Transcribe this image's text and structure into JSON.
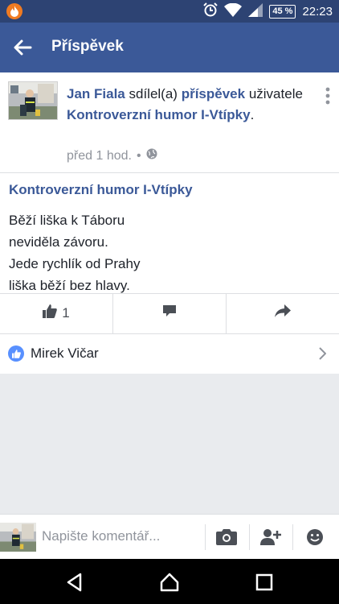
{
  "status_bar": {
    "battery": "45 %",
    "time": "22:23"
  },
  "app_bar": {
    "title": "Příspěvek"
  },
  "post": {
    "author": "Jan Fiala",
    "shared_text": "sdílel(a)",
    "post_link": "příspěvek",
    "user_text": "uživatele",
    "group": "Kontroverzní humor I-Vtípky",
    "period": ".",
    "time": "před 1 hod.",
    "dot": "•",
    "group_header": "Kontroverzní humor I-Vtípky",
    "body": "Běží liška k Táboru\nneviděla závoru.\nJede rychlík od Prahy\nliška běží bez hlavy.",
    "like_count": "1",
    "liked_by": "Mirek Vičar"
  },
  "composer": {
    "placeholder": "Napište komentář..."
  },
  "colors": {
    "facebook_blue": "#3b5998",
    "status_bar": "#2d4373",
    "like_blue": "#5890ff"
  }
}
